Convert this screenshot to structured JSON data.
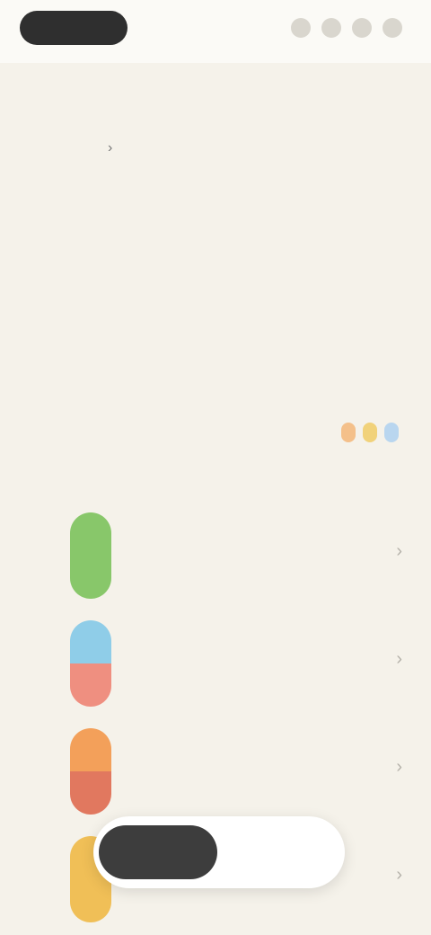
{
  "header": {
    "pill_label": "",
    "actions": [
      "",
      "",
      "",
      ""
    ]
  },
  "page": {
    "title": "",
    "intro": ""
  },
  "section": {
    "label": "",
    "legend_more": ""
  },
  "items": [
    {
      "index": "",
      "kicker": "",
      "title": "",
      "subtitle": "",
      "colors": [
        "#88c76a"
      ]
    },
    {
      "index": "",
      "kicker": "",
      "title": "",
      "subtitle": "",
      "colors": [
        "#8fcde8",
        "#ef8f80"
      ]
    },
    {
      "index": "",
      "kicker": "",
      "title": "",
      "subtitle": "",
      "colors": [
        "#f3a05a",
        "#e1785f"
      ]
    },
    {
      "index": "",
      "kicker": "",
      "title": "",
      "subtitle": "",
      "colors": [
        "#f0bf57"
      ]
    }
  ],
  "legend_colors": [
    "#f4c08a",
    "#f1d27a",
    "#b9d6ef"
  ],
  "bottom": {
    "primary_label": "",
    "secondary_label": ""
  },
  "colors": {
    "background": "#f5f2ea",
    "dark": "#2f2f2f"
  }
}
